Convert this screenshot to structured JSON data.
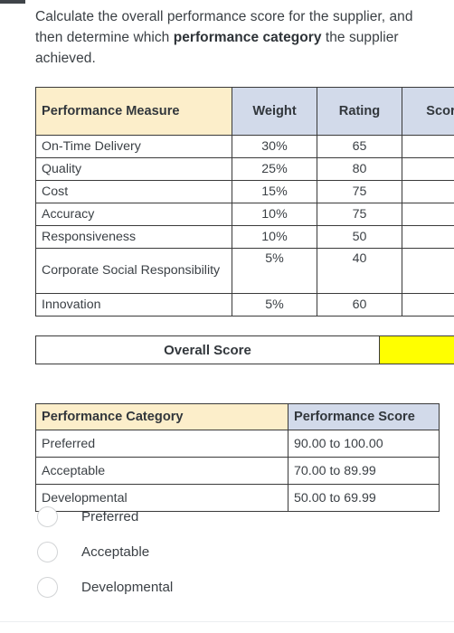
{
  "prompt": {
    "line1": "Calculate the overall performance score for the",
    "line2_pre": "supplier, and then determine which ",
    "line2_bold": "performance",
    "line3_bold": "category",
    "line3_post": " the supplier achieved."
  },
  "measures_table": {
    "headers": {
      "measure": "Performance Measure",
      "weight": "Weight",
      "rating": "Rating",
      "score": "Score"
    },
    "rows": [
      {
        "measure": "On-Time Delivery",
        "weight": "30%",
        "rating": "65",
        "score": ""
      },
      {
        "measure": "Quality",
        "weight": "25%",
        "rating": "80",
        "score": ""
      },
      {
        "measure": "Cost",
        "weight": "15%",
        "rating": "75",
        "score": ""
      },
      {
        "measure": "Accuracy",
        "weight": "10%",
        "rating": "75",
        "score": ""
      },
      {
        "measure": "Responsiveness",
        "weight": "10%",
        "rating": "50",
        "score": ""
      },
      {
        "measure": "Corporate Social Responsibility",
        "weight": "5%",
        "rating": "40",
        "score": ""
      },
      {
        "measure": "Innovation",
        "weight": "5%",
        "rating": "60",
        "score": ""
      }
    ]
  },
  "overall": {
    "label": "Overall Score",
    "value": "",
    "highlight_color": "#ffff00"
  },
  "category_table": {
    "headers": {
      "category": "Performance Category",
      "score": "Performance Score"
    },
    "rows": [
      {
        "category": "Preferred",
        "score": "90.00 to 100.00"
      },
      {
        "category": "Acceptable",
        "score": "70.00 to 89.99"
      },
      {
        "category": "Developmental",
        "score": "50.00 to 69.99"
      }
    ]
  },
  "choices": {
    "options": [
      {
        "label": "Preferred",
        "selected": false
      },
      {
        "label": "Acceptable",
        "selected": false
      },
      {
        "label": "Developmental",
        "selected": false
      }
    ]
  },
  "colors": {
    "header_cream": "#fceeca",
    "header_blue": "#d2daea",
    "answer_yellow": "#ffff00",
    "border": "#3a3a3a",
    "text": "#3b4045"
  }
}
